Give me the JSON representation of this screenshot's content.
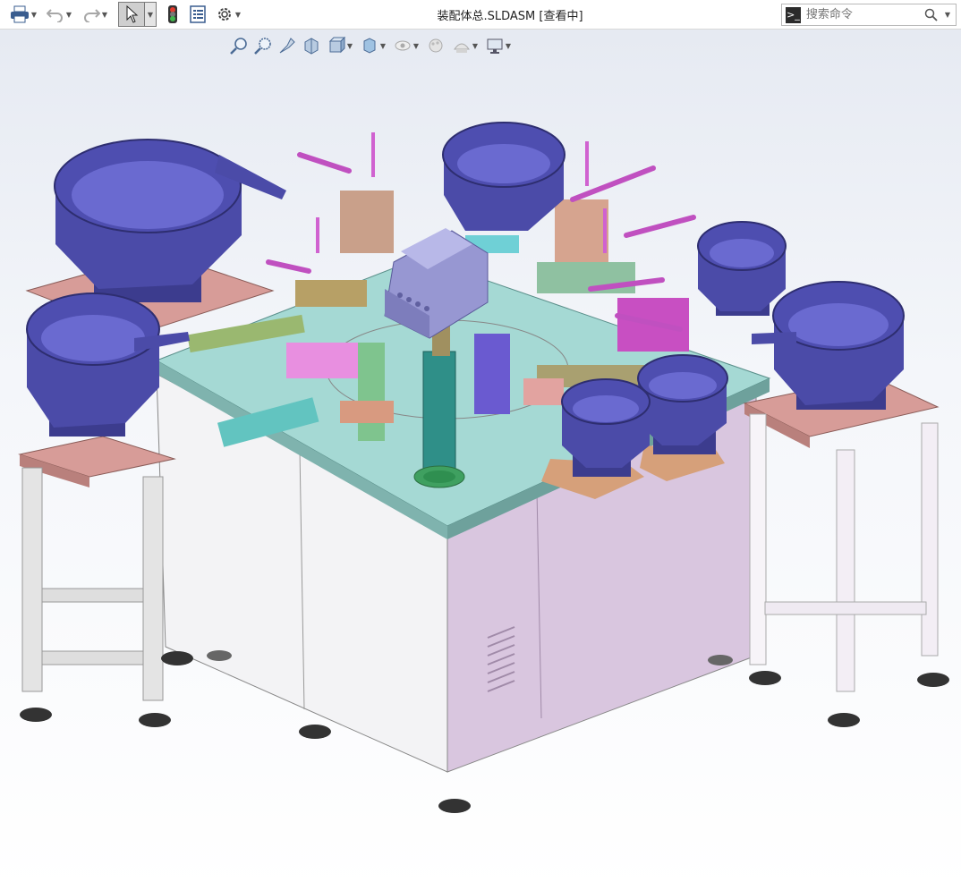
{
  "window": {
    "title": "装配体总.SLDASM [查看中]"
  },
  "toolbar": {
    "icons": [
      "print-icon",
      "undo-icon",
      "redo-icon",
      "select-arrow-icon",
      "traffic-light-icon",
      "file-properties-icon",
      "options-gear-icon"
    ]
  },
  "search": {
    "placeholder": "搜索命令"
  },
  "heads_up": {
    "icons": [
      "zoom-to-fit-icon",
      "zoom-to-area-icon",
      "previous-view-icon",
      "section-view-icon",
      "view-orientation-icon",
      "display-style-icon",
      "hide-show-items-icon",
      "edit-appearance-icon",
      "apply-scene-icon",
      "view-settings-icon"
    ]
  },
  "colors": {
    "bowl": "#4b4ba8",
    "table_top": "#9fd6d2",
    "cabinet": "#d7c4dd",
    "stand_top": "#d89a96",
    "frame": "#e9e9e9"
  }
}
